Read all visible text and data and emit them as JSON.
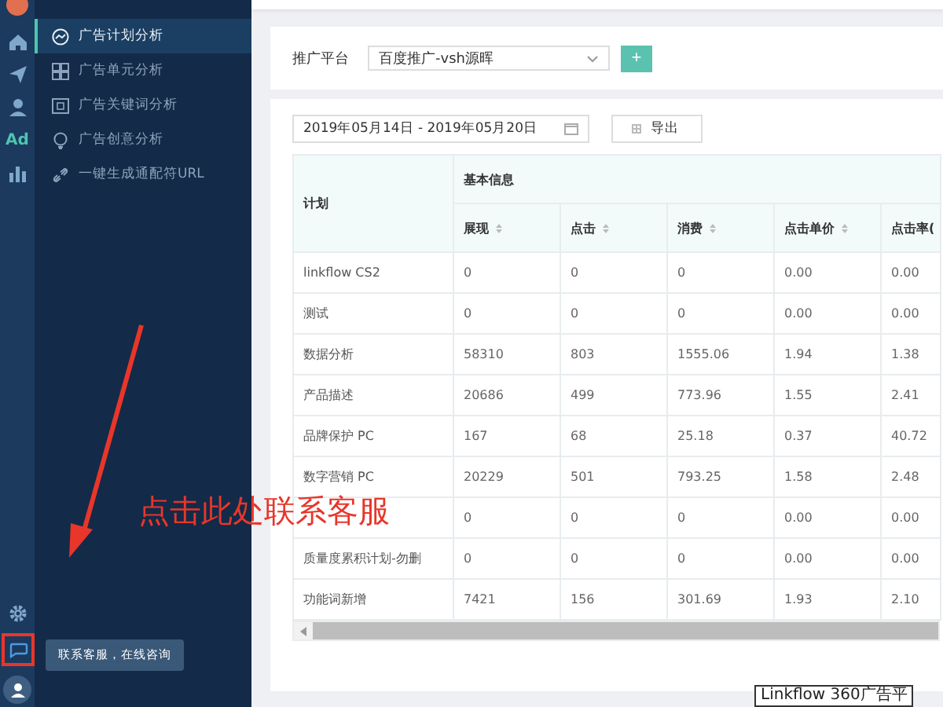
{
  "rail": {
    "items": [
      {
        "selected": false
      },
      {
        "selected": false
      },
      {
        "selected": false
      },
      {
        "label": "Ad",
        "selected": true
      },
      {
        "selected": false
      }
    ],
    "chat_highlighted": true
  },
  "nav": {
    "items": [
      {
        "label": "广告计划分析",
        "selected": true
      },
      {
        "label": "广告单元分析",
        "selected": false
      },
      {
        "label": "广告关键词分析",
        "selected": false
      },
      {
        "label": "广告创意分析",
        "selected": false
      },
      {
        "label": "一键生成通配符URL",
        "selected": false
      }
    ]
  },
  "filter": {
    "label": "推广平台",
    "value": "百度推广-vsh源晖",
    "add_button": "+"
  },
  "toolbar": {
    "date_range": "2019年05月14日 - 2019年05月20日",
    "export_button": "导出"
  },
  "table": {
    "first_column": "计划",
    "group": "基本信息",
    "columns": [
      "展现",
      "点击",
      "消费",
      "点击单价",
      "点击率("
    ],
    "rows": [
      {
        "name": "linkflow CS2",
        "cells": [
          "0",
          "0",
          "0",
          "0.00",
          "0.00"
        ]
      },
      {
        "name": "测试",
        "cells": [
          "0",
          "0",
          "0",
          "0.00",
          "0.00"
        ]
      },
      {
        "name": "数据分析",
        "cells": [
          "58310",
          "803",
          "1555.06",
          "1.94",
          "1.38"
        ]
      },
      {
        "name": "产品描述",
        "cells": [
          "20686",
          "499",
          "773.96",
          "1.55",
          "2.41"
        ]
      },
      {
        "name": "品牌保护 PC",
        "cells": [
          "167",
          "68",
          "25.18",
          "0.37",
          "40.72"
        ]
      },
      {
        "name": "数字营销 PC",
        "cells": [
          "20229",
          "501",
          "793.25",
          "1.58",
          "2.48"
        ]
      },
      {
        "cells": [
          "0",
          "0",
          "0",
          "0.00",
          "0.00"
        ]
      },
      {
        "name": "质量度累积计划-勿删",
        "cells": [
          "0",
          "0",
          "0",
          "0.00",
          "0.00"
        ]
      },
      {
        "name": "功能词新增",
        "cells": [
          "7421",
          "156",
          "301.69",
          "1.93",
          "2.10"
        ]
      }
    ]
  },
  "tooltip": "联系客服，在线咨询",
  "annotation": {
    "text": "点击此处联系客服"
  },
  "footer_tooltip": "Linkflow 360广告平"
}
